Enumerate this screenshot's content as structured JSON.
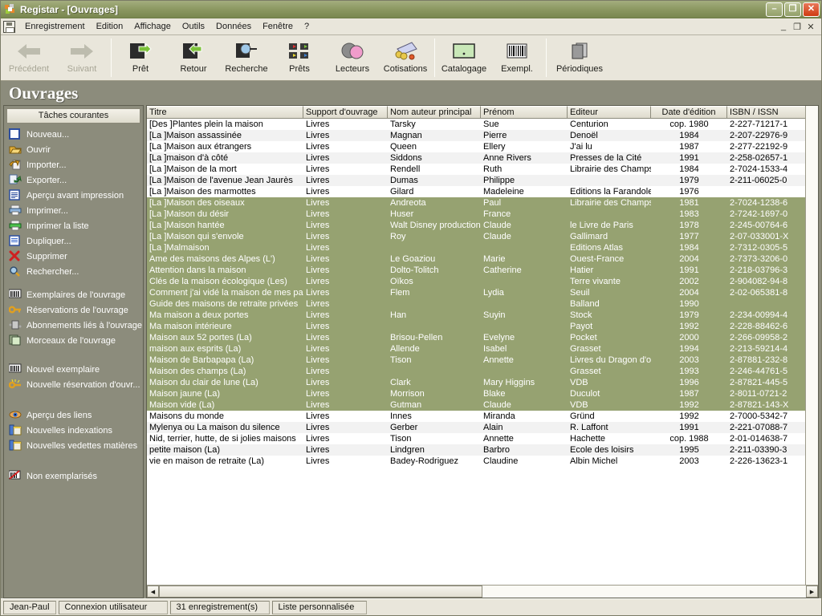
{
  "window": {
    "title": "Registar  - [Ouvrages]",
    "app_icon": "registar-logo-icon",
    "minimize": "–",
    "maximize": "❐",
    "close": "✕"
  },
  "mdi_child": {
    "minimize": "_",
    "restore": "❐",
    "close": "✕"
  },
  "menubar": {
    "doc_icon": "record-document-icon",
    "items": [
      {
        "label": "Enregistrement"
      },
      {
        "label": "Edition"
      },
      {
        "label": "Affichage"
      },
      {
        "label": "Outils"
      },
      {
        "label": "Données"
      },
      {
        "label": "Fenêtre"
      },
      {
        "label": "?"
      }
    ]
  },
  "toolbar": {
    "groups": [
      {
        "buttons": [
          {
            "label": "Précédent",
            "icon": "arrow-left-icon",
            "disabled": true
          },
          {
            "label": "Suivant",
            "icon": "arrow-right-icon",
            "disabled": true
          }
        ]
      },
      {
        "buttons": [
          {
            "label": "Prêt",
            "icon": "loan-out-icon",
            "disabled": false
          },
          {
            "label": "Retour",
            "icon": "loan-return-icon",
            "disabled": false
          },
          {
            "label": "Recherche",
            "icon": "search-magnifier-icon",
            "disabled": false
          },
          {
            "label": "Prêts",
            "icon": "loans-list-icon",
            "disabled": false
          },
          {
            "label": "Lecteurs",
            "icon": "readers-icon",
            "disabled": false
          },
          {
            "label": "Cotisations",
            "icon": "subscriptions-coins-icon",
            "disabled": false
          }
        ]
      },
      {
        "buttons": [
          {
            "label": "Catalogage",
            "icon": "cataloging-card-icon",
            "disabled": false
          },
          {
            "label": "Exempl.",
            "icon": "barcode-icon",
            "disabled": false
          }
        ]
      },
      {
        "buttons": [
          {
            "label": "Périodiques",
            "icon": "periodicals-icon",
            "disabled": false
          }
        ]
      }
    ]
  },
  "page": {
    "title": "Ouvrages"
  },
  "sidebar": {
    "header": "Tâches courantes",
    "groups": [
      {
        "items": [
          {
            "label": "Nouveau...",
            "icon": "new-document-icon"
          },
          {
            "label": "Ouvrir",
            "icon": "open-folder-icon"
          },
          {
            "label": "Importer...",
            "icon": "import-icon"
          },
          {
            "label": "Exporter...",
            "icon": "export-icon"
          },
          {
            "label": "Aperçu avant impression",
            "icon": "print-preview-icon"
          },
          {
            "label": "Imprimer...",
            "icon": "printer-icon"
          },
          {
            "label": "Imprimer la liste",
            "icon": "print-list-icon"
          },
          {
            "label": "Dupliquer...",
            "icon": "duplicate-icon"
          },
          {
            "label": "Supprimer",
            "icon": "delete-cross-icon"
          },
          {
            "label": "Rechercher...",
            "icon": "search-magnifier-icon"
          }
        ]
      },
      {
        "items": [
          {
            "label": "Exemplaires de l'ouvrage",
            "icon": "barcode-icon"
          },
          {
            "label": "Réservations de l'ouvrage",
            "icon": "key-icon"
          },
          {
            "label": "Abonnements liés à l'ouvrage",
            "icon": "subscription-icon"
          },
          {
            "label": "Morceaux de l'ouvrage",
            "icon": "pieces-stack-icon"
          }
        ]
      },
      {
        "items": [
          {
            "label": "Nouvel exemplaire",
            "icon": "barcode-icon"
          },
          {
            "label": "Nouvelle réservation d'ouvr...",
            "icon": "new-key-icon"
          }
        ]
      },
      {
        "items": [
          {
            "label": "Aperçu des liens",
            "icon": "eye-links-icon"
          },
          {
            "label": "Nouvelles indexations",
            "icon": "new-indexing-icon"
          },
          {
            "label": "Nouvelles vedettes matières",
            "icon": "new-subject-headings-icon"
          }
        ]
      },
      {
        "items": [
          {
            "label": "Non exemplarisés",
            "icon": "not-catalogued-icon"
          }
        ]
      }
    ]
  },
  "table": {
    "columns": [
      {
        "label": "Titre",
        "width": 195,
        "align": "left"
      },
      {
        "label": "Support d'ouvrage",
        "width": 105,
        "align": "left"
      },
      {
        "label": "Nom auteur principal",
        "width": 116,
        "align": "left"
      },
      {
        "label": "Prénom",
        "width": 108,
        "align": "left"
      },
      {
        "label": "Editeur",
        "width": 104,
        "align": "left"
      },
      {
        "label": "Date d'édition",
        "width": 95,
        "align": "center"
      },
      {
        "label": "ISBN / ISSN",
        "width": 115,
        "align": "left"
      }
    ],
    "rows": [
      {
        "selected": false,
        "cells": [
          "[Des ]Plantes plein la maison",
          "Livres",
          "Tarsky",
          "Sue",
          "Centurion",
          "cop. 1980",
          "2-227-71217-1"
        ]
      },
      {
        "selected": false,
        "cells": [
          "[La ]Maison assassinée",
          "Livres",
          "Magnan",
          "Pierre",
          "Denoël",
          "1984",
          "2-207-22976-9"
        ]
      },
      {
        "selected": false,
        "cells": [
          "[La ]Maison aux étrangers",
          "Livres",
          "Queen",
          "Ellery",
          "J'ai lu",
          "1987",
          "2-277-22192-9"
        ]
      },
      {
        "selected": false,
        "cells": [
          "[La ]maison d'à côté",
          "Livres",
          "Siddons",
          "Anne Rivers",
          "Presses de la Cité",
          "1991",
          "2-258-02657-1"
        ]
      },
      {
        "selected": false,
        "cells": [
          "[La ]Maison de la mort",
          "Livres",
          "Rendell",
          "Ruth",
          "Librairie des Champs",
          "1984",
          "2-7024-1533-4"
        ]
      },
      {
        "selected": false,
        "cells": [
          "[La ]Maison de l'avenue Jean Jaurès",
          "Livres",
          "Dumas",
          "Philippe",
          "",
          "1979",
          "2-211-06025-0"
        ]
      },
      {
        "selected": false,
        "cells": [
          "[La ]Maison des marmottes",
          "Livres",
          "Gilard",
          "Madeleine",
          "Editions la Farandole",
          "1976",
          ""
        ]
      },
      {
        "selected": true,
        "cells": [
          "[La ]Maison des oiseaux",
          "Livres",
          "Andreota",
          "Paul",
          "Librairie des Champs",
          "1981",
          "2-7024-1238-6"
        ]
      },
      {
        "selected": true,
        "cells": [
          "[La ]Maison du désir",
          "Livres",
          "Huser",
          "France",
          "",
          "1983",
          "2-7242-1697-0"
        ]
      },
      {
        "selected": true,
        "cells": [
          "[La ]Maison hantée",
          "Livres",
          "Walt Disney productions",
          "Claude",
          "le Livre de Paris",
          "1978",
          "2-245-00764-6"
        ]
      },
      {
        "selected": true,
        "cells": [
          "[La ]Maison qui s'envole",
          "Livres",
          "Roy",
          "Claude",
          "Gallimard",
          "1977",
          "2-07-033001-X"
        ]
      },
      {
        "selected": true,
        "cells": [
          "[La ]Malmaison",
          "Livres",
          "",
          "",
          "Editions Atlas",
          "1984",
          "2-7312-0305-5"
        ]
      },
      {
        "selected": true,
        "cells": [
          "Ame des maisons des Alpes (L')",
          "Livres",
          "Le Goaziou",
          "Marie",
          "Ouest-France",
          "2004",
          "2-7373-3206-0"
        ]
      },
      {
        "selected": true,
        "cells": [
          "Attention dans la maison",
          "Livres",
          "Dolto-Tolitch",
          "Catherine",
          "Hatier",
          "1991",
          "2-218-03796-3"
        ]
      },
      {
        "selected": true,
        "cells": [
          "Clés de la maison écologique (Les)",
          "Livres",
          "Oïkos",
          "",
          "Terre vivante",
          "2002",
          "2-904082-94-8"
        ]
      },
      {
        "selected": true,
        "cells": [
          "Comment j'ai vidé la maison de mes parer",
          "Livres",
          "Flem",
          "Lydia",
          "Seuil",
          "2004",
          "2-02-065381-8"
        ]
      },
      {
        "selected": true,
        "cells": [
          "Guide des maisons de retraite privées",
          "Livres",
          "",
          "",
          "Balland",
          "1990",
          ""
        ]
      },
      {
        "selected": true,
        "cells": [
          "Ma maison a deux portes",
          "Livres",
          "Han",
          "Suyin",
          "Stock",
          "1979",
          "2-234-00994-4"
        ]
      },
      {
        "selected": true,
        "cells": [
          "Ma maison intérieure",
          "Livres",
          "",
          "",
          "Payot",
          "1992",
          "2-228-88462-6"
        ]
      },
      {
        "selected": true,
        "cells": [
          "Maison aux 52 portes (La)",
          "Livres",
          "Brisou-Pellen",
          "Evelyne",
          "Pocket",
          "2000",
          "2-266-09958-2"
        ]
      },
      {
        "selected": true,
        "cells": [
          "maison aux esprits (La)",
          "Livres",
          "Allende",
          "Isabel",
          "Grasset",
          "1994",
          "2-213-59214-4"
        ]
      },
      {
        "selected": true,
        "cells": [
          "Maison de Barbapapa (La)",
          "Livres",
          "Tison",
          "Annette",
          "Livres du Dragon d'o",
          "2003",
          "2-87881-232-8"
        ]
      },
      {
        "selected": true,
        "cells": [
          "Maison des champs (La)",
          "Livres",
          "",
          "",
          "Grasset",
          "1993",
          "2-246-44761-5"
        ]
      },
      {
        "selected": true,
        "cells": [
          "Maison du clair de lune (La)",
          "Livres",
          "Clark",
          "Mary Higgins",
          "VDB",
          "1996",
          "2-87821-445-5"
        ]
      },
      {
        "selected": true,
        "cells": [
          "Maison jaune (La)",
          "Livres",
          "Morrison",
          "Blake",
          "Duculot",
          "1987",
          "2-8011-0721-2"
        ]
      },
      {
        "selected": true,
        "cells": [
          "Maison vide (La)",
          "Livres",
          "Gutman",
          "Claude",
          "VDB",
          "1992",
          "2-87821-143-X"
        ]
      },
      {
        "selected": false,
        "cells": [
          "Maisons du monde",
          "Livres",
          "Innes",
          "Miranda",
          "Gründ",
          "1992",
          "2-7000-5342-7"
        ]
      },
      {
        "selected": false,
        "cells": [
          "Mylenya ou La maison du silence",
          "Livres",
          "Gerber",
          "Alain",
          "R. Laffont",
          "1991",
          "2-221-07088-7"
        ]
      },
      {
        "selected": false,
        "cells": [
          "Nid, terrier, hutte, de si jolies maisons",
          "Livres",
          "Tison",
          "Annette",
          "Hachette",
          "cop. 1988",
          "2-01-014638-7"
        ]
      },
      {
        "selected": false,
        "cells": [
          "petite maison (La)",
          "Livres",
          "Lindgren",
          "Barbro",
          "Ecole des loisirs",
          "1995",
          "2-211-03390-3"
        ]
      },
      {
        "selected": false,
        "cells": [
          "vie en maison de retraite (La)",
          "Livres",
          "Badey-Rodriguez",
          "Claudine",
          "Albin Michel",
          "2003",
          "2-226-13623-1"
        ]
      }
    ],
    "hscroll": {
      "left_arrow": "◀",
      "right_arrow": "▶",
      "thumb_percent": 50
    }
  },
  "statusbar": {
    "panels": [
      {
        "label": "Jean-Paul"
      },
      {
        "label": "Connexion utilisateur"
      },
      {
        "label": "31 enregistrement(s)"
      },
      {
        "label": "Liste personnalisée"
      }
    ]
  },
  "colors": {
    "titlebar": "#8e9a64",
    "selection": "#96a271",
    "page_header": "#8c8c7c",
    "toolbar_bg": "#e9e6db",
    "accent_green": "#7cc23a"
  }
}
